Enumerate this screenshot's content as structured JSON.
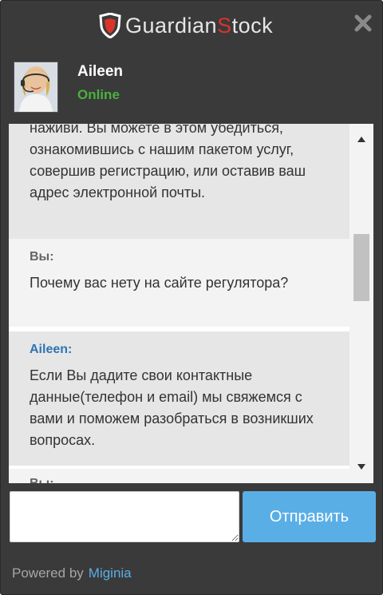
{
  "header": {
    "logo_part1": "Guardian",
    "logo_part2": "S",
    "logo_part3": "tock",
    "close_icon": "close-icon",
    "colors": {
      "accent": "#d9332b",
      "logo_text": "#e6e6e6",
      "background": "#3a3a3a"
    }
  },
  "agent": {
    "name": "Aileen",
    "status": "Online",
    "status_color": "#49b23d"
  },
  "messages": [
    {
      "role": "agent",
      "author": "",
      "text": "наживи. Вы можете в этом убедиться, ознакомившись с нашим пакетом услуг, совершив регистрацию, или оставив ваш адрес электронной почты."
    },
    {
      "role": "user",
      "author": "Вы:",
      "text": "Почему вас нету на сайте регулятора?"
    },
    {
      "role": "agent",
      "author": "Aileen:",
      "text": "Если Вы дадите свои контактные данные(телефон и email) мы свяжемся с вами и поможем разобраться в возникших вопросах."
    },
    {
      "role": "user",
      "author": "Вы:",
      "text": ""
    }
  ],
  "input": {
    "value": "",
    "placeholder": ""
  },
  "send_button": {
    "label": "Отправить",
    "color": "#5aaee6"
  },
  "footer": {
    "powered_by": "Powered by",
    "brand": "Miginia",
    "brand_color": "#5aaee6"
  }
}
